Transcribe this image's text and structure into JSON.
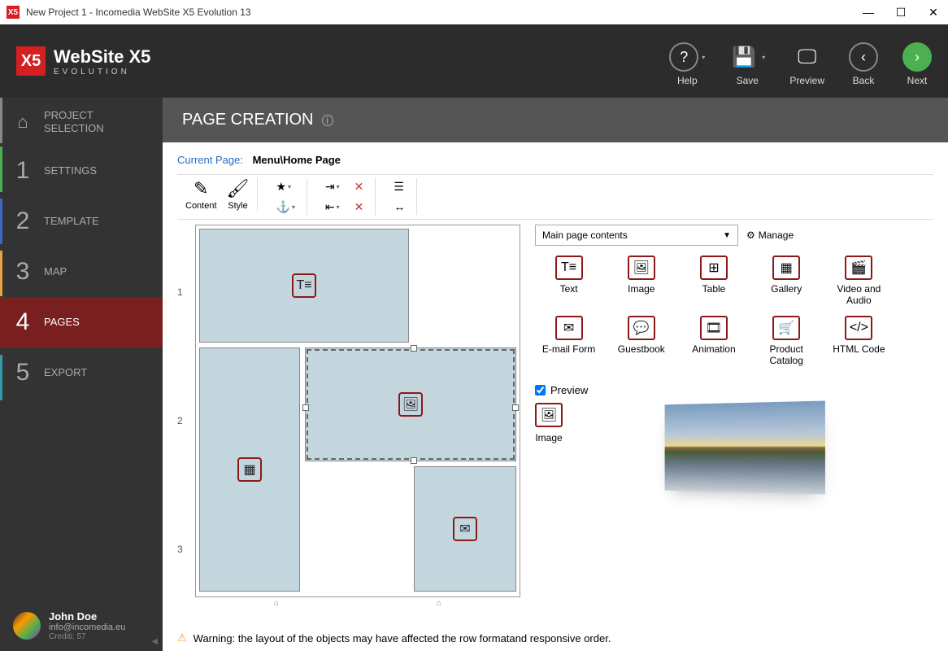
{
  "window": {
    "title": "New Project 1 - Incomedia WebSite X5 Evolution 13"
  },
  "branding": {
    "name": "WebSite X5",
    "sub": "EVOLUTION"
  },
  "header_buttons": {
    "help": "Help",
    "save": "Save",
    "preview": "Preview",
    "back": "Back",
    "next": "Next"
  },
  "sidebar": {
    "items": [
      {
        "label": "PROJECT\nSELECTION"
      },
      {
        "label": "SETTINGS"
      },
      {
        "label": "TEMPLATE"
      },
      {
        "label": "MAP"
      },
      {
        "label": "PAGES"
      },
      {
        "label": "EXPORT"
      }
    ],
    "user": {
      "name": "John Doe",
      "email": "info@incomedia.eu",
      "credits": "Crediti: 57"
    }
  },
  "page": {
    "title": "PAGE CREATION",
    "current_label": "Current Page:",
    "current_value": "Menu\\Home Page"
  },
  "toolbar": {
    "content": "Content",
    "style": "Style"
  },
  "rows": [
    "1",
    "2",
    "3"
  ],
  "palette": {
    "select": "Main page contents",
    "manage": "Manage",
    "objects": [
      {
        "label": "Text"
      },
      {
        "label": "Image"
      },
      {
        "label": "Table"
      },
      {
        "label": "Gallery"
      },
      {
        "label": "Video and Audio"
      },
      {
        "label": "E-mail Form"
      },
      {
        "label": "Guestbook"
      },
      {
        "label": "Animation"
      },
      {
        "label": "Product Catalog"
      },
      {
        "label": "HTML Code"
      }
    ]
  },
  "preview": {
    "label": "Preview",
    "selected": "Image"
  },
  "warning": "Warning: the layout of the objects may have affected the row formatand responsive order."
}
